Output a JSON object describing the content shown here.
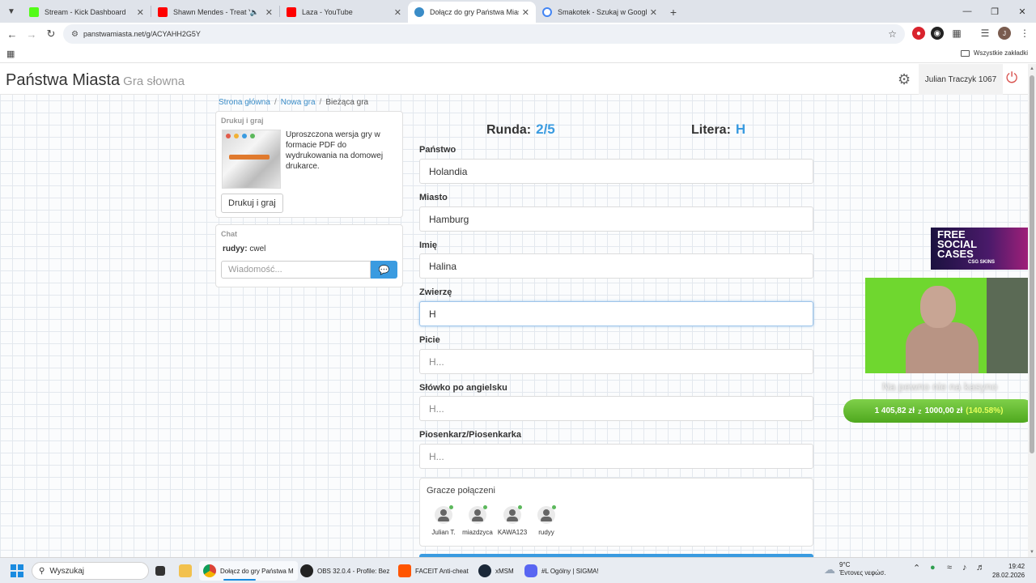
{
  "browser": {
    "tabs": [
      {
        "title": "Stream - Kick Dashboard",
        "color": "#53fc18"
      },
      {
        "title": "Shawn Mendes - Treat You",
        "color": "#ff0000"
      },
      {
        "title": "Laza - YouTube",
        "color": "#ff0000"
      },
      {
        "title": "Dołącz do gry Państwa Miasta",
        "color": "#3a8cc7"
      },
      {
        "title": "Smakotek - Szukaj w Google",
        "color": "#4285f4"
      }
    ],
    "url": "panstwamiasta.net/g/ACYAHH2G5Y",
    "bookmarks_all": "Wszystkie zakładki"
  },
  "site": {
    "brand": "Państwa Miasta",
    "brand_sub": "Gra słowna",
    "user": "Julian Traczyk 1067"
  },
  "breadcrumb": [
    "Strona główna",
    "Nowa gra",
    "Bieżąca gra"
  ],
  "print_panel": {
    "title": "Drukuj i graj",
    "desc": "Uproszczona wersja gry w formacie PDF do wydrukowania na domowej drukarce.",
    "button": "Drukuj i graj"
  },
  "chat": {
    "title": "Chat",
    "messages": [
      {
        "user": "rudyy:",
        "text": "cwel"
      }
    ],
    "placeholder": "Wiadomość..."
  },
  "game": {
    "round_label": "Runda:",
    "round_value": "2/5",
    "letter_label": "Litera:",
    "letter_value": "H",
    "fields": [
      {
        "label": "Państwo",
        "value": "Holandia",
        "placeholder": "H..."
      },
      {
        "label": "Miasto",
        "value": "Hamburg",
        "placeholder": "H..."
      },
      {
        "label": "Imię",
        "value": "Halina",
        "placeholder": "H..."
      },
      {
        "label": "Zwierzę",
        "value": "H",
        "placeholder": "H..."
      },
      {
        "label": "Picie",
        "value": "",
        "placeholder": "H..."
      },
      {
        "label": "Słówko po angielsku",
        "value": "",
        "placeholder": "H..."
      },
      {
        "label": "Piosenkarz/Piosenkarka",
        "value": "",
        "placeholder": "H..."
      }
    ]
  },
  "players": {
    "title": "Gracze połączeni",
    "list": [
      "Julian T.",
      "miazdzyca",
      "KAWA123",
      "rudyy"
    ]
  },
  "overlay": {
    "ad_line1": "FREE SOCIAL CASES",
    "ad_line2": "CSG SKINS",
    "caption": "Na pewno nie na kasyno",
    "balance": "1 405,82 zł",
    "balance_of": "z",
    "balance_target": "1000,00 zł",
    "balance_pct": "(140.58%)"
  },
  "taskbar": {
    "search": "Wyszukaj",
    "items": [
      {
        "label": "Dołącz do gry Państwa M",
        "color": "#e8a317"
      },
      {
        "label": "OBS 32.0.4 - Profile: Bez",
        "color": "#222222"
      },
      {
        "label": "FACEIT Anti-cheat",
        "color": "#ff5500"
      },
      {
        "label": "xMSM",
        "color": "#1b2838"
      },
      {
        "label": "#L   Ogólny | SIGMA!",
        "color": "#5865f2"
      }
    ],
    "weather_temp": "9°C",
    "weather_desc": "Έντονες νεφώσ.",
    "time": "19:42",
    "date": "28.02.2026"
  }
}
